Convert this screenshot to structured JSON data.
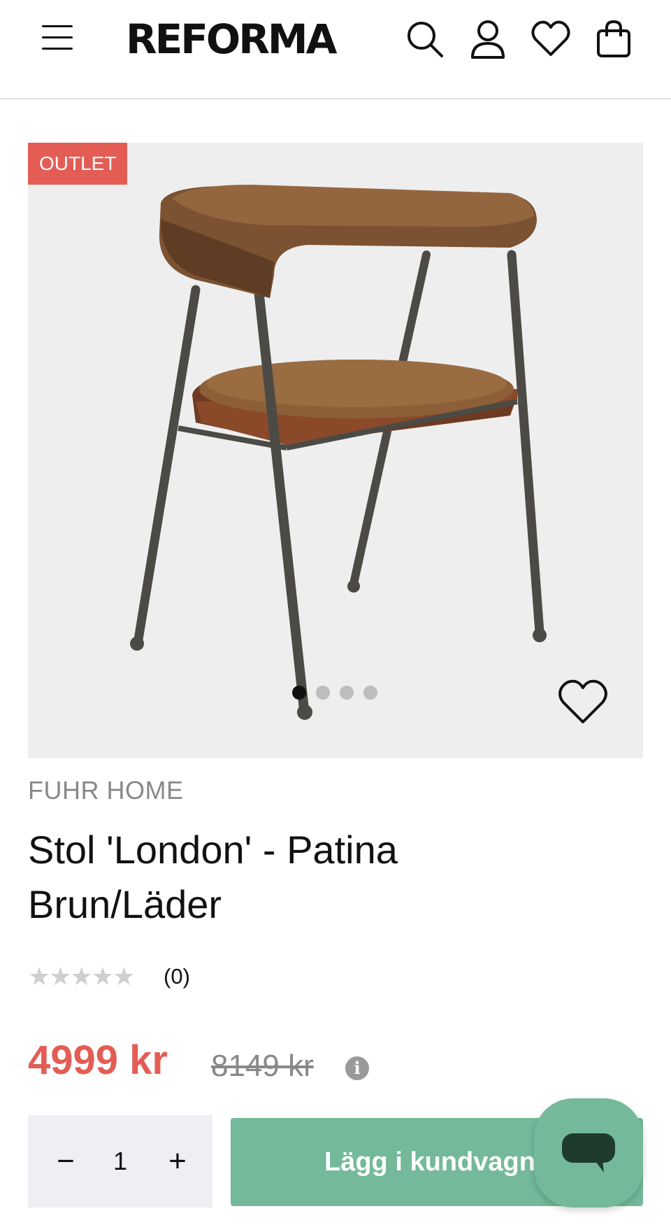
{
  "header": {
    "logo_text": "REFORMA",
    "icons": [
      "menu-icon",
      "search-icon",
      "user-icon",
      "heart-icon",
      "shopping-bag-icon"
    ]
  },
  "gallery": {
    "badge": "OUTLET",
    "image_count": 4,
    "active_index": 0
  },
  "product": {
    "brand": "FUHR HOME",
    "title": "Stol 'London' - Patina Brun/Läder",
    "rating_stars": "★★★★★",
    "rating_count": "(0)",
    "price": "4999 kr",
    "old_price": "8149 kr",
    "info_glyph": "i"
  },
  "cart": {
    "minus": "−",
    "quantity": "1",
    "plus": "+",
    "add_label": "Lägg i kundvagne"
  },
  "colors": {
    "accent_red": "#e35d55",
    "button_green": "#73b99a",
    "qty_bg": "#efeff3"
  }
}
